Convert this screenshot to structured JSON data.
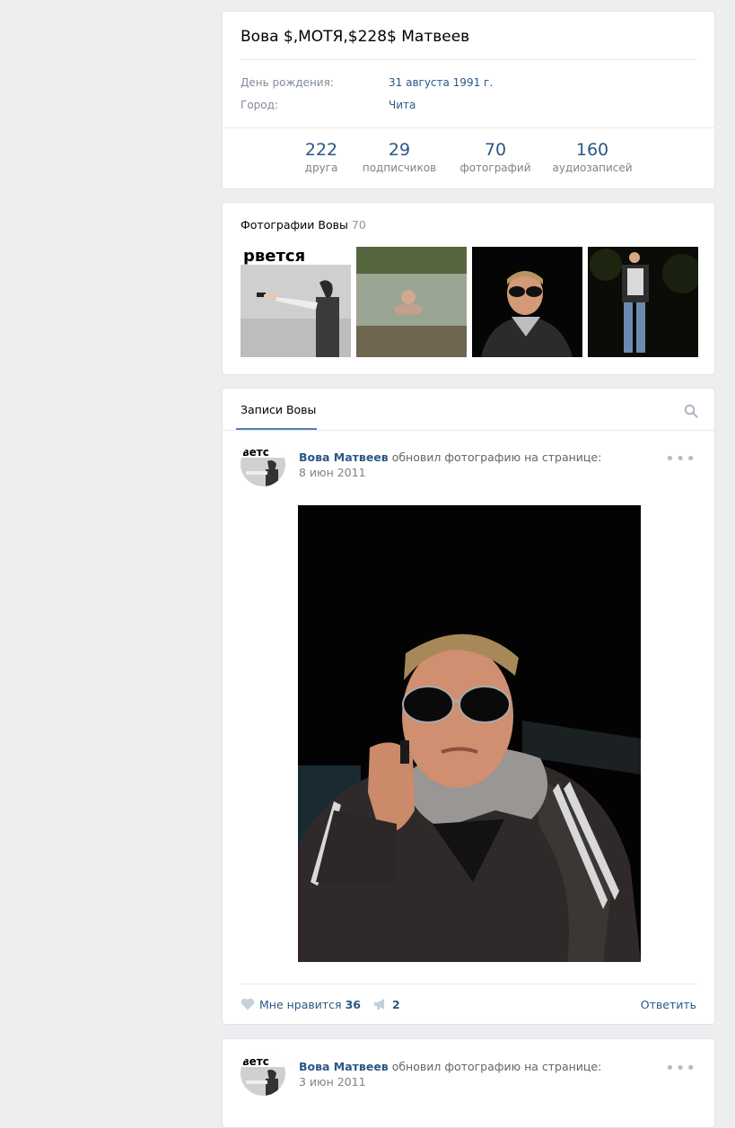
{
  "profile": {
    "name": "Вова $,МОТЯ,$228$ Матвеев",
    "birthday_label": "День рождения:",
    "birthday_value": "31 августа 1991 г.",
    "city_label": "Город:",
    "city_value": "Чита",
    "counters": [
      {
        "num": "222",
        "label": "друга"
      },
      {
        "num": "29",
        "label": "подписчиков"
      },
      {
        "num": "70",
        "label": "фотографий"
      },
      {
        "num": "160",
        "label": "аудиозаписей"
      }
    ]
  },
  "photos": {
    "title": "Фотографии Вовы",
    "count": "70",
    "first_thumb_caption": "рвется"
  },
  "wall": {
    "tab_label": "Записи Вовы",
    "posts": [
      {
        "author": "Вова Матвеев",
        "action": "обновил фотографию на странице:",
        "date": "8 июн 2011",
        "likes_label": "Мне нравится",
        "likes_count": "36",
        "shares_count": "2",
        "reply_label": "Ответить"
      },
      {
        "author": "Вова Матвеев",
        "action": "обновил фотографию на странице:",
        "date": "3 июн 2011"
      }
    ]
  },
  "colors": {
    "link": "#2a5885",
    "background": "#edeef0",
    "accent": "#5181b8"
  }
}
